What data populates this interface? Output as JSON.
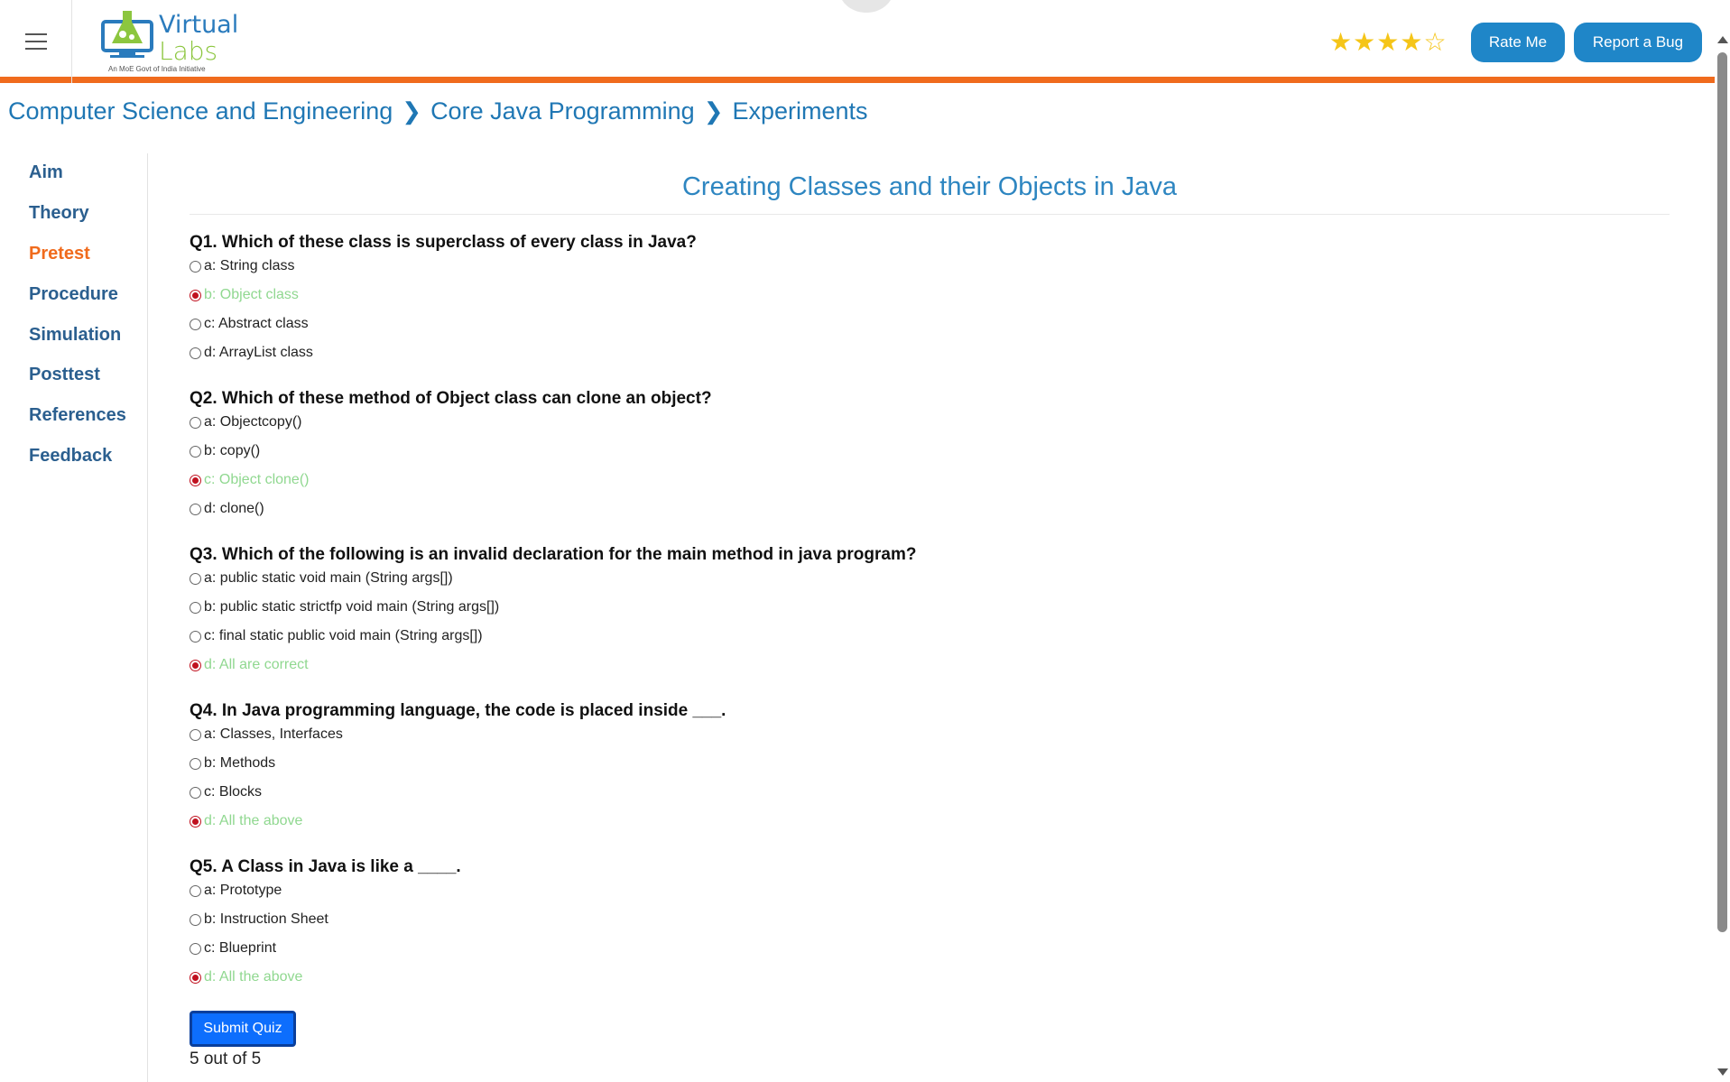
{
  "header": {
    "logo_line1": "Virtual",
    "logo_line2": "Labs",
    "logo_tagline": "An MoE Govt of India Initiative",
    "rating_stars_filled": 4,
    "rating_stars_total": 5,
    "rate_button": "Rate Me",
    "bug_button": "Report a Bug"
  },
  "breadcrumb": [
    "Computer Science and Engineering",
    "Core Java Programming",
    "Experiments"
  ],
  "sidebar": {
    "items": [
      {
        "label": "Aim"
      },
      {
        "label": "Theory"
      },
      {
        "label": "Pretest",
        "active": true
      },
      {
        "label": "Procedure"
      },
      {
        "label": "Simulation"
      },
      {
        "label": "Posttest"
      },
      {
        "label": "References"
      },
      {
        "label": "Feedback"
      }
    ]
  },
  "main": {
    "title": "Creating Classes and their Objects in Java",
    "questions": [
      {
        "text": "Q1. Which of these class is superclass of every class in Java?",
        "options": [
          "a: String class",
          "b: Object class",
          "c: Abstract class",
          "d: ArrayList class"
        ],
        "selected": 1
      },
      {
        "text": "Q2. Which of these method of Object class can clone an object?",
        "options": [
          "a: Objectcopy()",
          "b: copy()",
          "c: Object clone()",
          "d: clone()"
        ],
        "selected": 2
      },
      {
        "text": "Q3. Which of the following is an invalid declaration for the main method in java program?",
        "options": [
          "a: public static void main (String args[])",
          "b: public static strictfp void main (String args[])",
          "c: final static public void main (String args[])",
          "d: All are correct"
        ],
        "selected": 3
      },
      {
        "text": "Q4. In Java programming language, the code is placed inside ___.",
        "options": [
          "a: Classes, Interfaces",
          "b: Methods",
          "c: Blocks",
          "d: All the above"
        ],
        "selected": 3
      },
      {
        "text": "Q5. A Class in Java is like a ____.",
        "options": [
          "a: Prototype",
          "b: Instruction Sheet",
          "c: Blueprint",
          "d: All the above"
        ],
        "selected": 3
      }
    ],
    "submit_label": "Submit Quiz",
    "score_text": "5 out of 5"
  },
  "colors": {
    "accent_orange": "#f06b1d",
    "link_blue": "#1f77b4",
    "button_blue": "#1f86c8",
    "correct_green": "#90d890",
    "selected_red": "#c0111f"
  }
}
